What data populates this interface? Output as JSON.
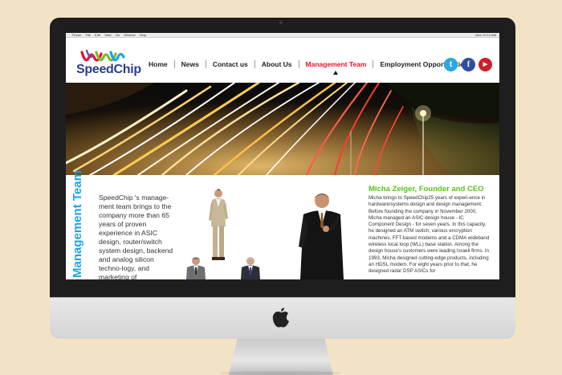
{
  "os_menu": {
    "items": [
      "Finder",
      "File",
      "Edit",
      "View",
      "Go",
      "Window",
      "Help"
    ],
    "right_status": "Mon 10:10 AM"
  },
  "site": {
    "brand": "SpeedChip",
    "nav": [
      {
        "label": "Home",
        "active": false
      },
      {
        "label": "News",
        "active": false
      },
      {
        "label": "Contact us",
        "active": false
      },
      {
        "label": "About Us",
        "active": false
      },
      {
        "label": "Management Team",
        "active": true
      },
      {
        "label": "Employment Opportunities",
        "active": false
      }
    ],
    "social": [
      {
        "name": "twitter-icon",
        "glyph": "t"
      },
      {
        "name": "facebook-icon",
        "glyph": "f"
      },
      {
        "name": "youtube-icon",
        "glyph": "▶"
      }
    ],
    "page_heading": "Management Team",
    "intro": "SpeedChip 's manage-ment team brings to the company more than 65 years of proven experience in ASIC design, router/switch system design, backend and analog silicon techno-logy, and marketing of",
    "ceo": {
      "name": "Micha Zeiger, Founder and CEO",
      "bio": "Micha brings to SpeedChip25 years of experi-ence in hardware/systems design and design management. Before founding the company in November 2000, Micha managed an ASIC design house - IC Component Design - for seven years. In this capacity, he designed an ATM switch, various encryption machines, FFT-based modems and a CDMA wideband wireless local loop (WLL) base station. Among the design house's customers were leading Israeli firms. In 1993, Micha designed cutting-edge products, including an HDSL modem. For eight years prior to that, he designed radar DSP ASICs for"
    }
  },
  "colors": {
    "accent_red": "#e8132a",
    "heading_blue": "#1fa3e6",
    "ceo_green": "#58c21d",
    "brand_navy": "#2a3d8f"
  }
}
